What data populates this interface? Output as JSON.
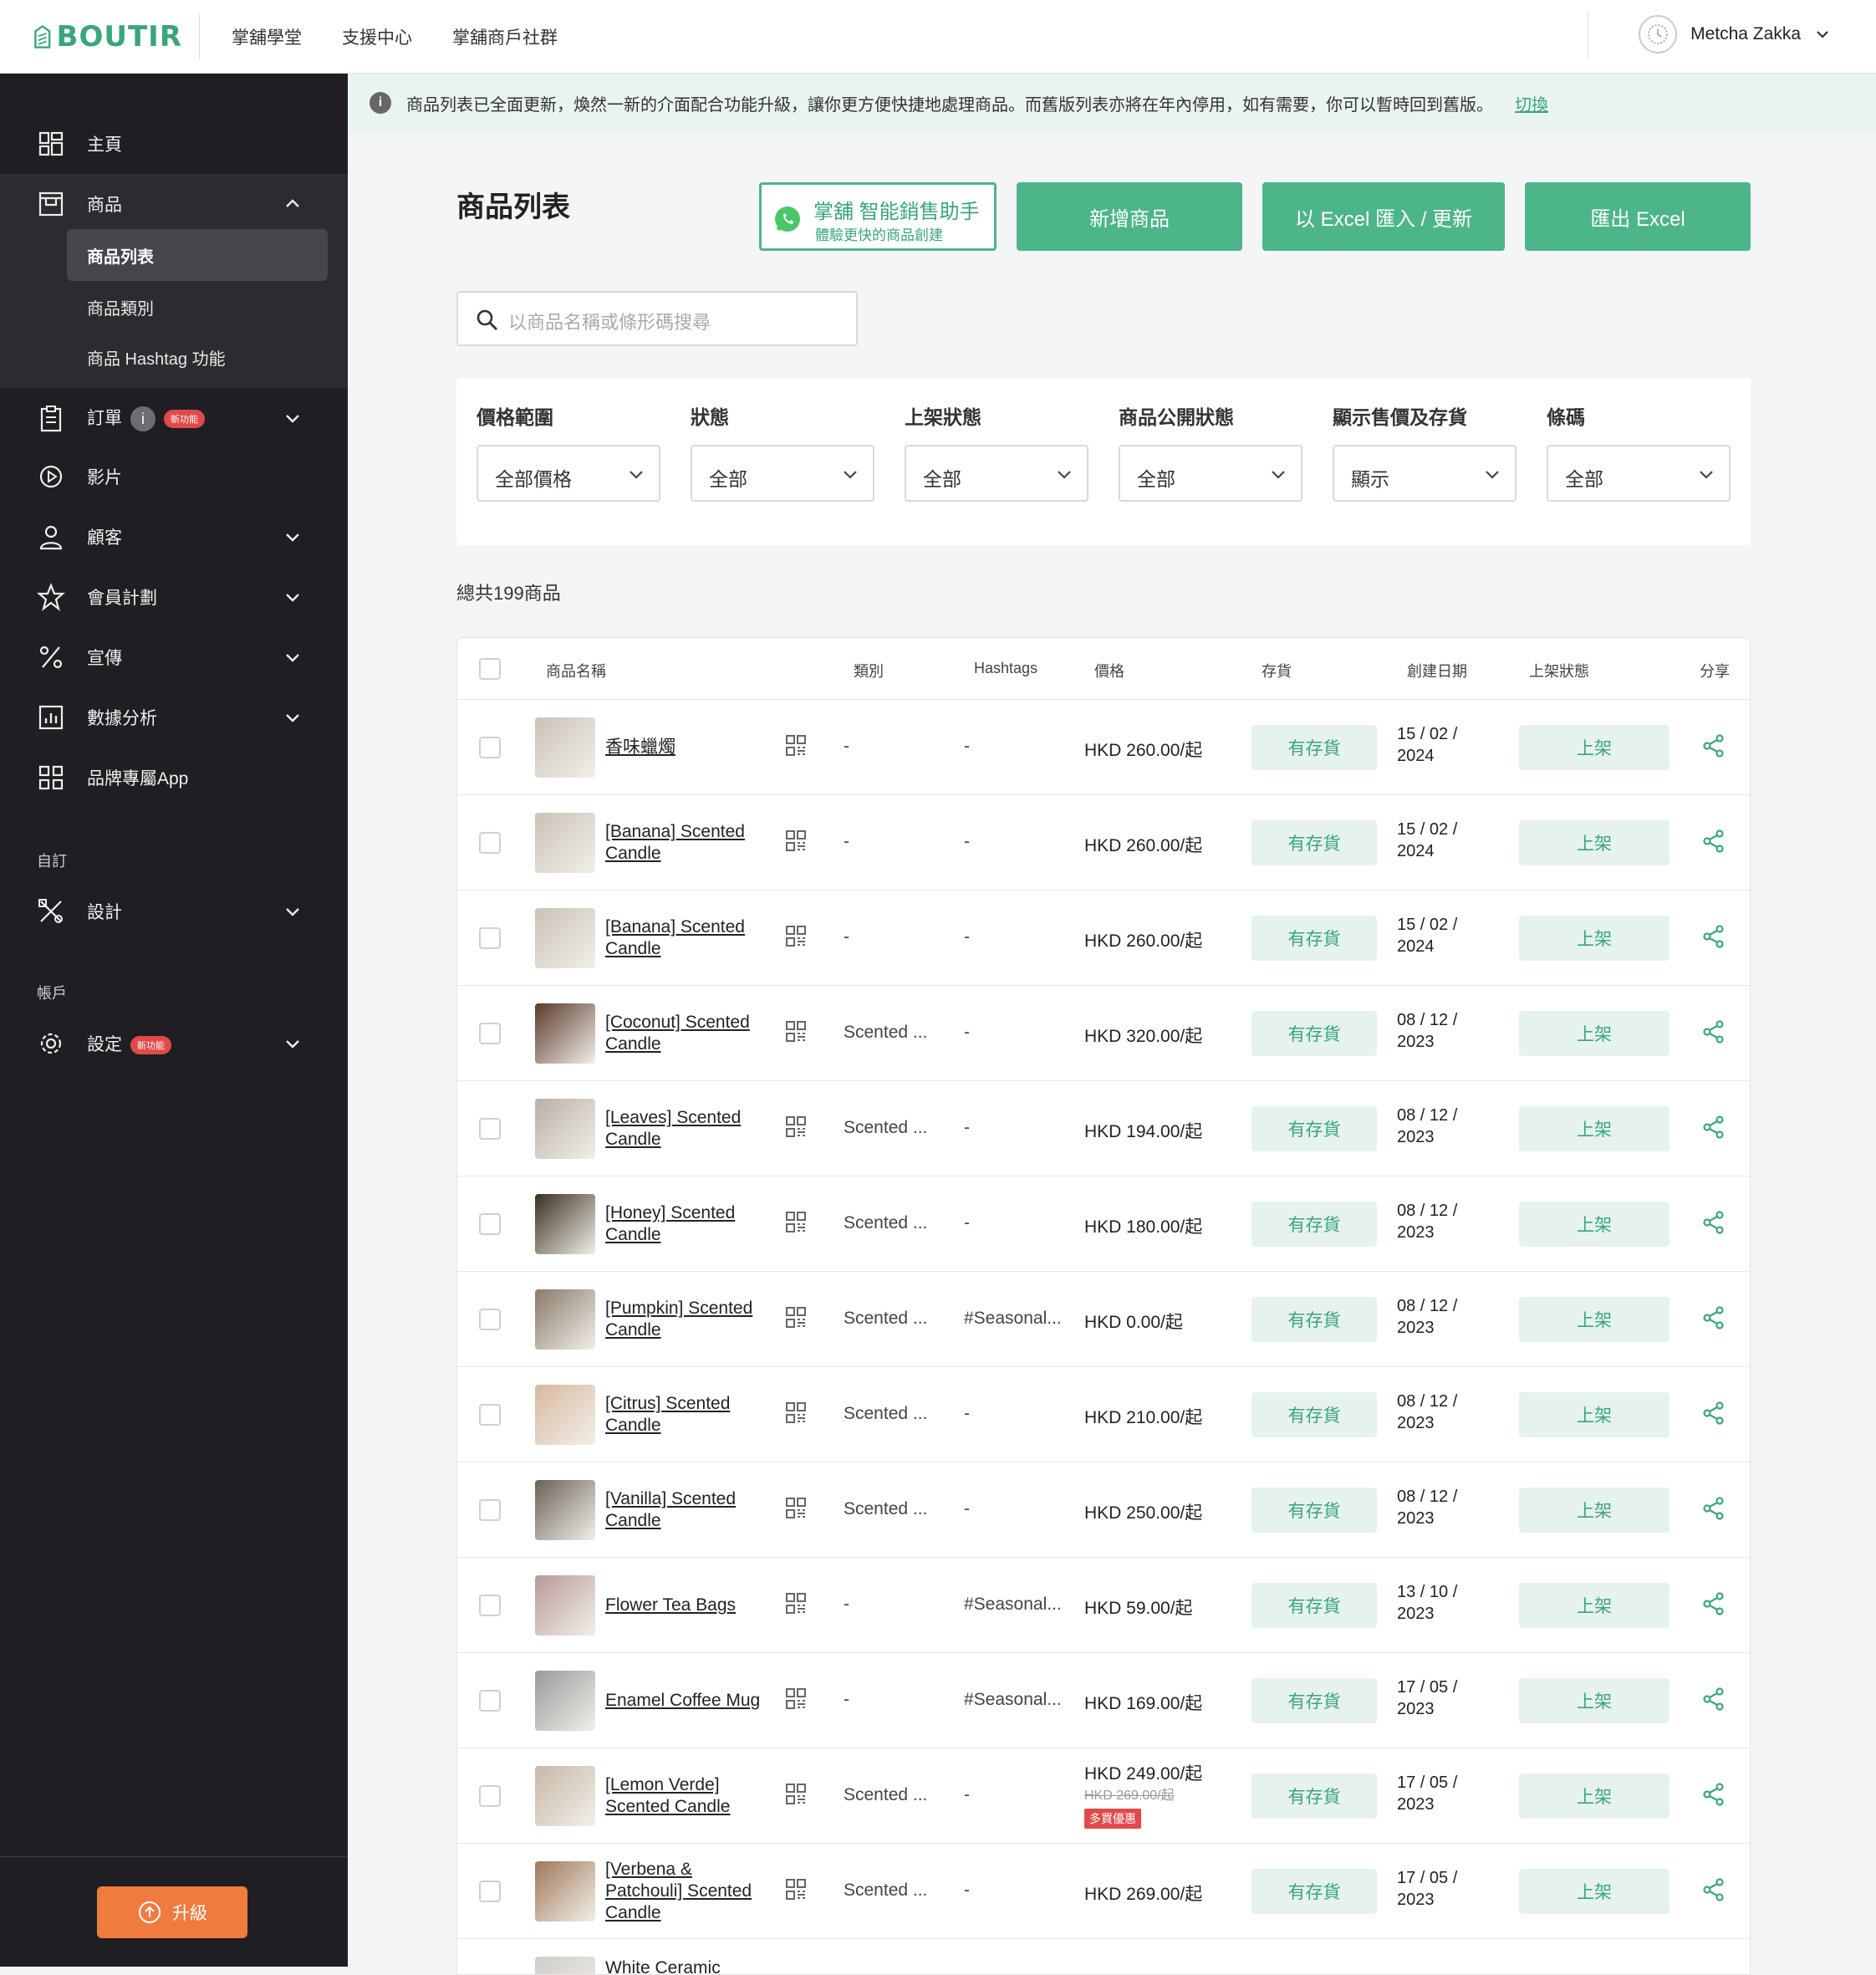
{
  "brand": {
    "name": "BOUTIR",
    "color": "#3aa67a"
  },
  "topnav": {
    "links": [
      "掌舖學堂",
      "支援中心",
      "掌舖商戶社群"
    ],
    "user": "Metcha Zakka"
  },
  "sidebar": {
    "home": "主頁",
    "products": "商品",
    "product_sub": [
      "商品列表",
      "商品類別",
      "商品 Hashtag 功能"
    ],
    "orders": "訂單",
    "orders_info": "i",
    "new_badge": "新功能",
    "videos": "影片",
    "customers": "顧客",
    "membership": "會員計劃",
    "promotion": "宣傳",
    "analytics": "數據分析",
    "brand_app": "品牌專屬App",
    "section_custom": "自訂",
    "design": "設計",
    "section_account": "帳戶",
    "settings": "設定",
    "upgrade": "升級"
  },
  "notice": {
    "icon": "i",
    "text": "商品列表已全面更新，煥然一新的介面配合功能升級，讓你更方便快捷地處理商品。而舊版列表亦將在年內停用，如有需要，你可以暫時回到舊版。",
    "link": "切換"
  },
  "page": {
    "title": "商品列表",
    "wa_title": "掌舖 智能銷售助手",
    "wa_sub": "體驗更快的商品創建",
    "add_product": "新增商品",
    "excel_import": "以 Excel 匯入 / 更新",
    "excel_export": "匯出 Excel",
    "search_placeholder": "以商品名稱或條形碼搜尋"
  },
  "filters": [
    {
      "label": "價格範圍",
      "value": "全部價格"
    },
    {
      "label": "狀態",
      "value": "全部"
    },
    {
      "label": "上架狀態",
      "value": "全部"
    },
    {
      "label": "商品公開狀態",
      "value": "全部"
    },
    {
      "label": "顯示售價及存貨",
      "value": "顯示"
    },
    {
      "label": "條碼",
      "value": "全部"
    }
  ],
  "total": "總共199商品",
  "table": {
    "headers": {
      "name": "商品名稱",
      "category": "類別",
      "hashtags": "Hashtags",
      "price": "價格",
      "stock": "存貨",
      "created": "創建日期",
      "shelf": "上架狀態",
      "share": "分享"
    },
    "rows": [
      {
        "name": "香味蠟燭",
        "category": "-",
        "hashtags": "-",
        "price": "HKD 260.00/起",
        "stock": "有存貨",
        "date1": "15 / 02 /",
        "date2": "2024",
        "shelf": "上架",
        "thumb": "#c9c2b8"
      },
      {
        "name": "[Banana] Scented Candle",
        "category": "-",
        "hashtags": "-",
        "price": "HKD 260.00/起",
        "stock": "有存貨",
        "date1": "15 / 02 /",
        "date2": "2024",
        "shelf": "上架",
        "thumb": "#c9c2b8"
      },
      {
        "name": "[Banana] Scented Candle",
        "category": "-",
        "hashtags": "-",
        "price": "HKD 260.00/起",
        "stock": "有存貨",
        "date1": "15 / 02 /",
        "date2": "2024",
        "shelf": "上架",
        "thumb": "#c9c2b8"
      },
      {
        "name": "[Coconut] Scented Candle",
        "category": "Scented ...",
        "hashtags": "-",
        "price": "HKD 320.00/起",
        "stock": "有存貨",
        "date1": "08 / 12 /",
        "date2": "2023",
        "shelf": "上架",
        "thumb": "#5a3a2a"
      },
      {
        "name": "[Leaves] Scented Candle",
        "category": "Scented ...",
        "hashtags": "-",
        "price": "HKD 194.00/起",
        "stock": "有存貨",
        "date1": "08 / 12 /",
        "date2": "2023",
        "shelf": "上架",
        "thumb": "#b8b0a8"
      },
      {
        "name": "[Honey] Scented Candle",
        "category": "Scented ...",
        "hashtags": "-",
        "price": "HKD 180.00/起",
        "stock": "有存貨",
        "date1": "08 / 12 /",
        "date2": "2023",
        "shelf": "上架",
        "thumb": "#3a3020"
      },
      {
        "name": "[Pumpkin] Scented Candle",
        "category": "Scented ...",
        "hashtags": "#Seasonal...",
        "price": "HKD 0.00/起",
        "stock": "有存貨",
        "date1": "08 / 12 /",
        "date2": "2023",
        "shelf": "上架",
        "thumb": "#8a7a6a"
      },
      {
        "name": "[Citrus] Scented Candle",
        "category": "Scented ...",
        "hashtags": "-",
        "price": "HKD 210.00/起",
        "stock": "有存貨",
        "date1": "08 / 12 /",
        "date2": "2023",
        "shelf": "上架",
        "thumb": "#d8b8a0"
      },
      {
        "name": "[Vanilla] Scented Candle",
        "category": "Scented ...",
        "hashtags": "-",
        "price": "HKD 250.00/起",
        "stock": "有存貨",
        "date1": "08 / 12 /",
        "date2": "2023",
        "shelf": "上架",
        "thumb": "#6a6258"
      },
      {
        "name": "Flower Tea Bags",
        "category": "-",
        "hashtags": "#Seasonal...",
        "price": "HKD 59.00/起",
        "stock": "有存貨",
        "date1": "13 / 10 /",
        "date2": "2023",
        "shelf": "上架",
        "thumb": "#b89a98"
      },
      {
        "name": "Enamel Coffee Mug",
        "category": "-",
        "hashtags": "#Seasonal...",
        "price": "HKD 169.00/起",
        "stock": "有存貨",
        "date1": "17 / 05 /",
        "date2": "2023",
        "shelf": "上架",
        "thumb": "#9a9a9a"
      },
      {
        "name": "[Lemon Verde] Scented Candle",
        "category": "Scented ...",
        "hashtags": "-",
        "price": "HKD 249.00/起",
        "price_old": "HKD 269.00/起",
        "promo": "多買優惠",
        "stock": "有存貨",
        "date1": "17 / 05 /",
        "date2": "2023",
        "shelf": "上架",
        "thumb": "#c8b8a8"
      },
      {
        "name": "[Verbena & Patchouli] Scented Candle",
        "category": "Scented ...",
        "hashtags": "-",
        "price": "HKD 269.00/起",
        "stock": "有存貨",
        "date1": "17 / 05 /",
        "date2": "2023",
        "shelf": "上架",
        "thumb": "#a0785a"
      },
      {
        "name": "White Ceramic",
        "category": "",
        "hashtags": "",
        "price": "",
        "stock": "",
        "date1": "",
        "date2": "",
        "shelf": "",
        "thumb": "#d0ccc8"
      }
    ]
  }
}
